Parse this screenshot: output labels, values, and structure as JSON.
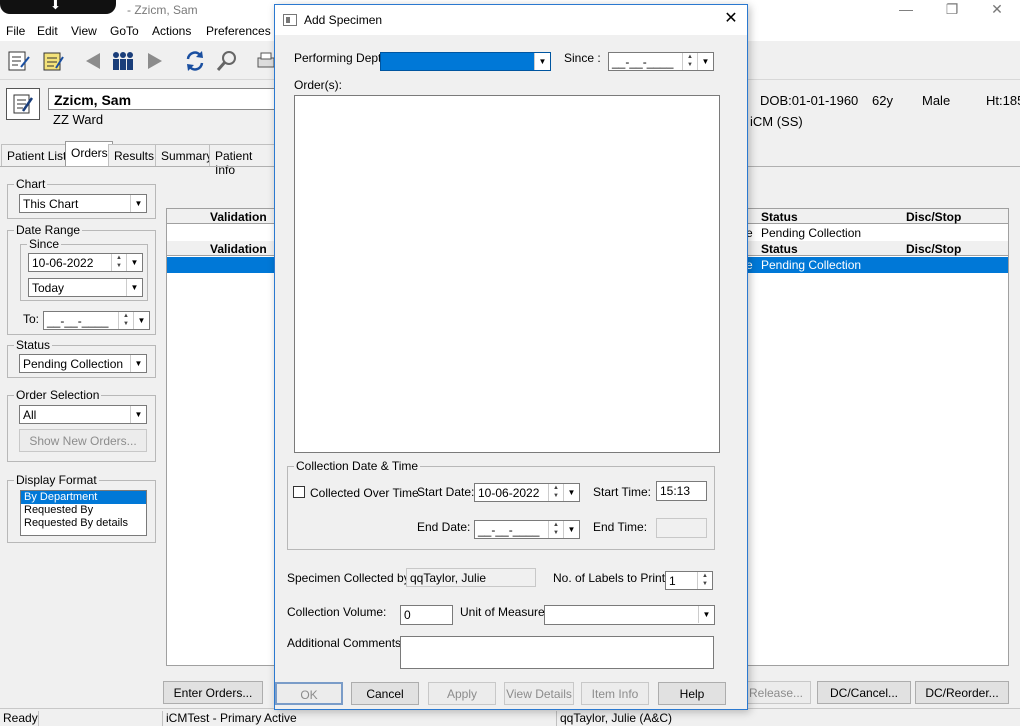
{
  "window": {
    "title": "- Zzicm, Sam",
    "controls": {
      "minimize": "—",
      "maximize": "❐",
      "close": "✕"
    }
  },
  "menu": [
    "File",
    "Edit",
    "View",
    "GoTo",
    "Actions",
    "Preferences"
  ],
  "toolbar_icons": [
    "patient-list-icon",
    "orders-icon",
    "back-arrow-icon",
    "patients-icon",
    "forward-arrow-icon",
    "refresh-icon",
    "search-icon",
    "print-icon"
  ],
  "patient": {
    "name": "Zzicm, Sam",
    "ward": "ZZ Ward",
    "dob": "DOB:01-01-1960",
    "age": "62y",
    "sex": "Male",
    "height": "Ht:185",
    "unit": "iCM (SS)"
  },
  "tabs": [
    "Patient List",
    "Orders",
    "Results",
    "Summary",
    "Patient Info"
  ],
  "filters": {
    "chart_label": "Chart",
    "chart_value": "This Chart",
    "date_range_label": "Date Range",
    "since_label": "Since",
    "since_value": "10-06-2022",
    "since_period": "Today",
    "to_label": "To:",
    "to_value": "__-__-____",
    "status_label": "Status",
    "status_value": "Pending Collection",
    "order_selection_label": "Order Selection",
    "order_selection_value": "All",
    "show_new_orders": "Show New Orders...",
    "display_format_label": "Display Format",
    "display_format_options": [
      "By Department",
      "Requested By",
      "Requested By details"
    ]
  },
  "grid": {
    "headers": {
      "validation": "Validation",
      "status": "Status",
      "disc_stop": "Disc/Stop"
    },
    "rows": [
      {
        "prefix": "e",
        "status": "Pending Collection"
      },
      {
        "prefix": "e",
        "status": "Pending Collection"
      }
    ]
  },
  "bottom_buttons": {
    "enter_orders": "Enter Orders...",
    "release": "Release...",
    "dc_cancel": "DC/Cancel...",
    "dc_reorder": "DC/Reorder..."
  },
  "statusbar": {
    "ready": "Ready",
    "environment": "iCMTest - Primary Active",
    "user": "qqTaylor, Julie  (A&C)"
  },
  "dialog": {
    "title": "Add Specimen",
    "close": "✕",
    "performing_dept_label": "Performing Dept.",
    "performing_dept_value": "",
    "since_label": "Since :",
    "since_value": "__-__-____",
    "orders_label": "Order(s):",
    "collection_group_label": "Collection Date & Time",
    "collected_over_time_label": "Collected Over Time",
    "start_date_label": "Start Date:",
    "start_date_value": "10-06-2022",
    "start_time_label": "Start Time:",
    "start_time_value": "15:13",
    "end_date_label": "End Date:",
    "end_date_value": "__-__-____",
    "end_time_label": "End Time:",
    "end_time_value": "",
    "collected_by_label": "Specimen Collected by:",
    "collected_by_value": "qqTaylor, Julie",
    "labels_to_print_label": "No. of Labels to Print:",
    "labels_to_print_value": "1",
    "collection_volume_label": "Collection Volume:",
    "collection_volume_value": "0",
    "unit_of_measure_label": "Unit of Measure:",
    "unit_of_measure_value": "",
    "additional_comments_label": "Additional Comments:",
    "additional_comments_value": "",
    "buttons": {
      "ok": "OK",
      "cancel": "Cancel",
      "apply": "Apply",
      "view_details": "View Details",
      "item_info": "Item Info",
      "help": "Help"
    }
  },
  "colors": {
    "selection": "#0078d7",
    "dialog_border": "#2b79d0"
  }
}
